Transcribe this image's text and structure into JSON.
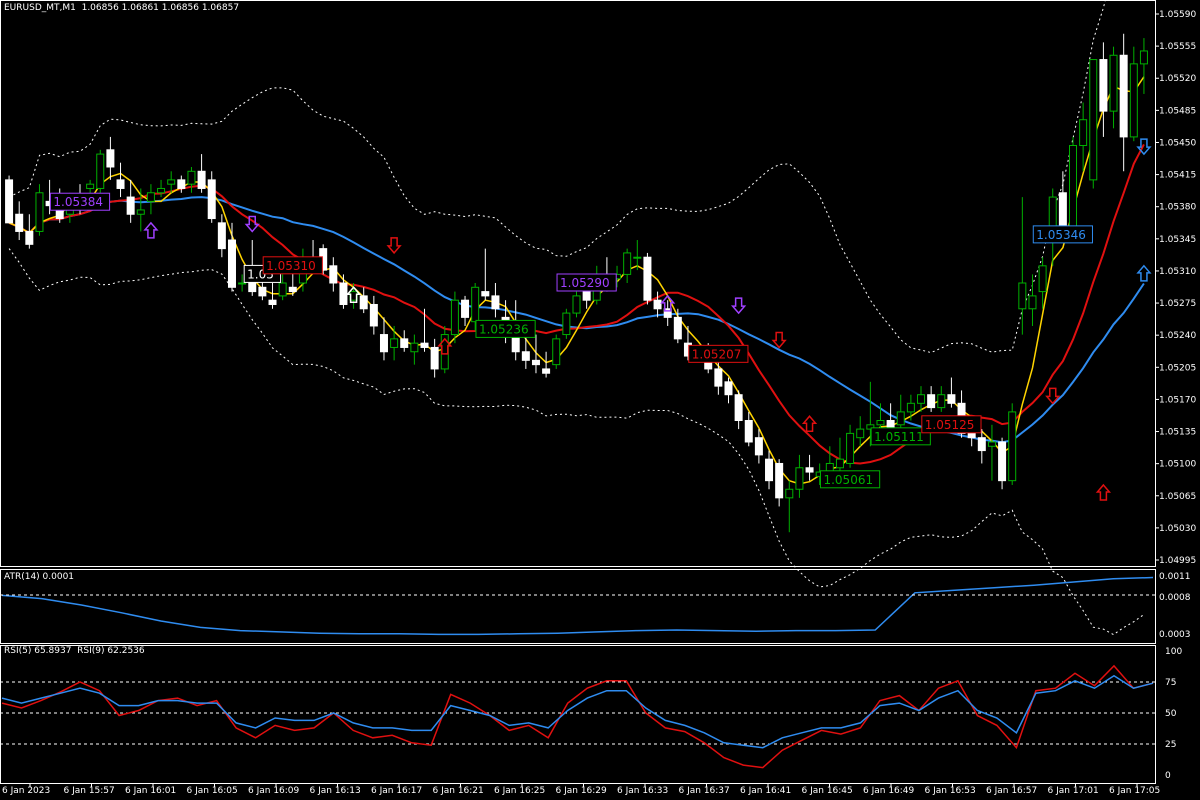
{
  "header": {
    "main": "EURUSD_MT,M1  1.06856 1.06861 1.06856 1.06857",
    "atr": "ATR(14) 0.0001",
    "rsi": "RSI(5) 65.8937  RSI(9) 62.2536"
  },
  "colors": {
    "background": "#000000",
    "frame": "#ffffff",
    "bull_body": "#000000",
    "bull_wick": "#00b000",
    "bear_body": "#ffffff",
    "bear_wick": "#ffffff",
    "ma_fast": "#ffd400",
    "ma_mid": "#e01010",
    "ma_slow": "#2f8cf0",
    "bands": "#ffffff",
    "atr": "#2f8cf0",
    "rsi5": "#e01010",
    "rsi9": "#2f8cf0"
  },
  "chart_data": [
    {
      "type": "candlestick",
      "name": "EURUSD_MT,M1",
      "ylim": [
        1.0497,
        1.0561
      ],
      "price_ticks": [
        "1.05590",
        "1.05555",
        "1.05520",
        "1.05485",
        "1.05450",
        "1.05415",
        "1.05380",
        "1.05345",
        "1.05310",
        "1.05275",
        "1.05240",
        "1.05205",
        "1.05170",
        "1.05135",
        "1.05100",
        "1.05065",
        "1.05030",
        "1.04995"
      ],
      "time_labels": [
        "6 Jan 2023",
        "6 Jan 15:57",
        "6 Jan 16:01",
        "6 Jan 16:05",
        "6 Jan 16:09",
        "6 Jan 16:13",
        "6 Jan 16:17",
        "6 Jan 16:21",
        "6 Jan 16:25",
        "6 Jan 16:29",
        "6 Jan 16:33",
        "6 Jan 16:37",
        "6 Jan 16:41",
        "6 Jan 16:45",
        "6 Jan 16:49",
        "6 Jan 16:53",
        "6 Jan 16:57",
        "6 Jan 17:01",
        "6 Jan 17:05"
      ],
      "candles": [
        [
          1.0541,
          1.05415,
          1.0536,
          1.0536
        ],
        [
          1.0537,
          1.05385,
          1.0534,
          1.0535
        ],
        [
          1.0535,
          1.0537,
          1.0533,
          1.05335
        ],
        [
          1.0535,
          1.05405,
          1.05345,
          1.05395
        ],
        [
          1.05385,
          1.0541,
          1.0537,
          1.0538
        ],
        [
          1.0538,
          1.054,
          1.0536,
          1.05365
        ],
        [
          1.0537,
          1.05395,
          1.0536,
          1.0539
        ],
        [
          1.0539,
          1.05405,
          1.0537,
          1.05385
        ],
        [
          1.054,
          1.0541,
          1.0538,
          1.05405
        ],
        [
          1.054,
          1.05445,
          1.0539,
          1.0544
        ],
        [
          1.05445,
          1.0546,
          1.0541,
          1.05425
        ],
        [
          1.0541,
          1.0543,
          1.0539,
          1.054
        ],
        [
          1.0539,
          1.0541,
          1.0536,
          1.0537
        ],
        [
          1.0537,
          1.054,
          1.0535,
          1.05375
        ],
        [
          1.05385,
          1.05405,
          1.0537,
          1.05395
        ],
        [
          1.05395,
          1.0541,
          1.0539,
          1.054
        ],
        [
          1.05405,
          1.0542,
          1.05395,
          1.0541
        ],
        [
          1.0541,
          1.05415,
          1.05395,
          1.054
        ],
        [
          1.05405,
          1.05425,
          1.05395,
          1.0542
        ],
        [
          1.0542,
          1.0544,
          1.05395,
          1.054
        ],
        [
          1.0541,
          1.0542,
          1.0536,
          1.05365
        ],
        [
          1.0536,
          1.0537,
          1.0532,
          1.0533
        ],
        [
          1.0534,
          1.0536,
          1.0528,
          1.05285
        ],
        [
          1.0529,
          1.053,
          1.0528,
          1.0529
        ],
        [
          1.053,
          1.0534,
          1.05275,
          1.0528
        ],
        [
          1.05285,
          1.0531,
          1.0527,
          1.05275
        ],
        [
          1.0527,
          1.0529,
          1.0526,
          1.05265
        ],
        [
          1.05275,
          1.053,
          1.0527,
          1.0529
        ],
        [
          1.05285,
          1.05305,
          1.05275,
          1.0528
        ],
        [
          1.0529,
          1.0533,
          1.0528,
          1.0532
        ],
        [
          1.0532,
          1.0534,
          1.0531,
          1.05315
        ],
        [
          1.0533,
          1.05335,
          1.053,
          1.05305
        ],
        [
          1.0531,
          1.0532,
          1.0528,
          1.0529
        ],
        [
          1.0529,
          1.053,
          1.0526,
          1.05265
        ],
        [
          1.0527,
          1.0529,
          1.0526,
          1.0528
        ],
        [
          1.05275,
          1.05285,
          1.05255,
          1.0526
        ],
        [
          1.05265,
          1.05275,
          1.0523,
          1.0524
        ],
        [
          1.0523,
          1.0525,
          1.052,
          1.0521
        ],
        [
          1.05215,
          1.0524,
          1.052,
          1.05225
        ],
        [
          1.05225,
          1.05235,
          1.0521,
          1.05215
        ],
        [
          1.0521,
          1.0523,
          1.05195,
          1.0522
        ],
        [
          1.0522,
          1.0526,
          1.0521,
          1.05215
        ],
        [
          1.05215,
          1.05225,
          1.0518,
          1.0519
        ],
        [
          1.0519,
          1.0524,
          1.05185,
          1.0523
        ],
        [
          1.0523,
          1.0528,
          1.0522,
          1.0527
        ],
        [
          1.0527,
          1.05275,
          1.0524,
          1.0525
        ],
        [
          1.05245,
          1.0529,
          1.05235,
          1.05285
        ],
        [
          1.0528,
          1.0533,
          1.0527,
          1.05275
        ],
        [
          1.05275,
          1.0529,
          1.0525,
          1.0526
        ],
        [
          1.0525,
          1.0527,
          1.0522,
          1.0523
        ],
        [
          1.0524,
          1.0527,
          1.052,
          1.0521
        ],
        [
          1.0521,
          1.0523,
          1.0519,
          1.052
        ],
        [
          1.052,
          1.0523,
          1.05185,
          1.05195
        ],
        [
          1.0519,
          1.0521,
          1.0518,
          1.05185
        ],
        [
          1.05195,
          1.0523,
          1.0519,
          1.05225
        ],
        [
          1.0523,
          1.0526,
          1.05225,
          1.05255
        ],
        [
          1.05255,
          1.0528,
          1.0525,
          1.05275
        ],
        [
          1.0528,
          1.053,
          1.0526,
          1.0527
        ],
        [
          1.0527,
          1.0531,
          1.05265,
          1.053
        ],
        [
          1.053,
          1.0532,
          1.0528,
          1.05295
        ],
        [
          1.05295,
          1.0531,
          1.05285,
          1.053
        ],
        [
          1.053,
          1.0533,
          1.0529,
          1.05325
        ],
        [
          1.0532,
          1.0534,
          1.05305,
          1.0532
        ],
        [
          1.0532,
          1.05325,
          1.05265,
          1.0527
        ],
        [
          1.0527,
          1.0528,
          1.0525,
          1.0526
        ],
        [
          1.0526,
          1.0527,
          1.0524,
          1.0525
        ],
        [
          1.0525,
          1.0526,
          1.0522,
          1.05225
        ],
        [
          1.0522,
          1.0524,
          1.052,
          1.05205
        ],
        [
          1.0521,
          1.05215,
          1.052,
          1.05208
        ],
        [
          1.0521,
          1.0522,
          1.05185,
          1.0519
        ],
        [
          1.0519,
          1.052,
          1.0516,
          1.0517
        ],
        [
          1.05175,
          1.0518,
          1.0515,
          1.0516
        ],
        [
          1.0516,
          1.05165,
          1.0512,
          1.0513
        ],
        [
          1.0513,
          1.0514,
          1.051,
          1.05105
        ],
        [
          1.0511,
          1.0512,
          1.0508,
          1.0509
        ],
        [
          1.05085,
          1.05095,
          1.0505,
          1.0506
        ],
        [
          1.0508,
          1.05085,
          1.0503,
          1.0504
        ],
        [
          1.0504,
          1.0506,
          1.05,
          1.0505
        ],
        [
          1.0505,
          1.0509,
          1.0504,
          1.05075
        ],
        [
          1.05075,
          1.0509,
          1.0506,
          1.0507
        ],
        [
          1.05065,
          1.0508,
          1.05055,
          1.0507
        ],
        [
          1.0507,
          1.051,
          1.0506,
          1.0508
        ],
        [
          1.05075,
          1.0511,
          1.0506,
          1.05085
        ],
        [
          1.0508,
          1.05125,
          1.05075,
          1.05115
        ],
        [
          1.0511,
          1.05135,
          1.051,
          1.0512
        ],
        [
          1.0512,
          1.05175,
          1.051,
          1.05125
        ],
        [
          1.05125,
          1.0515,
          1.0511,
          1.0513
        ],
        [
          1.0513,
          1.0515,
          1.05115,
          1.0512
        ],
        [
          1.05125,
          1.0516,
          1.0511,
          1.0514
        ],
        [
          1.0514,
          1.0516,
          1.0513,
          1.0515
        ],
        [
          1.0515,
          1.0517,
          1.0514,
          1.0516
        ],
        [
          1.0516,
          1.0517,
          1.0514,
          1.05145
        ],
        [
          1.05145,
          1.0517,
          1.0514,
          1.0516
        ],
        [
          1.0516,
          1.0518,
          1.05145,
          1.0515
        ],
        [
          1.0515,
          1.05165,
          1.0511,
          1.05115
        ],
        [
          1.0512,
          1.0513,
          1.051,
          1.0511
        ],
        [
          1.0511,
          1.0512,
          1.0508,
          1.05095
        ],
        [
          1.051,
          1.05125,
          1.0506,
          1.05105
        ],
        [
          1.05105,
          1.0511,
          1.0505,
          1.0506
        ],
        [
          1.0506,
          1.0515,
          1.05055,
          1.0514
        ],
        [
          1.0526,
          1.0539,
          1.0523,
          1.0529
        ],
        [
          1.0526,
          1.053,
          1.0524,
          1.05275
        ],
        [
          1.0528,
          1.0532,
          1.0526,
          1.0531
        ],
        [
          1.0534,
          1.054,
          1.0531,
          1.0539
        ],
        [
          1.05395,
          1.0542,
          1.0534,
          1.0535
        ],
        [
          1.0535,
          1.0546,
          1.0534,
          1.0545
        ],
        [
          1.0545,
          1.055,
          1.0542,
          1.0548
        ],
        [
          1.0541,
          1.0555,
          1.054,
          1.0555
        ],
        [
          1.0555,
          1.0557,
          1.0546,
          1.0549
        ],
        [
          1.0549,
          1.05565,
          1.0547,
          1.05555
        ],
        [
          1.05555,
          1.0558,
          1.0542,
          1.0546
        ],
        [
          1.0546,
          1.05565,
          1.05455,
          1.05545
        ],
        [
          1.05545,
          1.05575,
          1.0551,
          1.0556
        ]
      ]
    },
    {
      "type": "line",
      "name": "ATR(14)",
      "ylim": [
        0.0002,
        0.0012
      ],
      "ticks": [
        "0.0011",
        "0.0008",
        "0.0003"
      ],
      "values": [
        0.00085,
        0.0008,
        0.0007,
        0.00058,
        0.00045,
        0.00035,
        0.0003,
        0.00028,
        0.00026,
        0.00025,
        0.00025,
        0.00024,
        0.00024,
        0.00025,
        0.00026,
        0.00028,
        0.0003,
        0.00031,
        0.0003,
        0.00029,
        0.0003,
        0.0003,
        0.00031,
        0.00089,
        0.00093,
        0.00097,
        0.00101,
        0.00106,
        0.00111,
        0.00113
      ]
    },
    {
      "type": "line",
      "name": "RSI",
      "ylim": [
        0,
        100
      ],
      "ticks": [
        "100",
        "75",
        "50",
        "25",
        "0"
      ],
      "series": [
        {
          "name": "RSI(5) 65.8937",
          "values": [
            58,
            54,
            60,
            67,
            75,
            68,
            48,
            52,
            60,
            62,
            56,
            60,
            38,
            30,
            40,
            36,
            38,
            50,
            36,
            30,
            32,
            26,
            24,
            65,
            58,
            48,
            36,
            40,
            30,
            58,
            70,
            76,
            76,
            50,
            38,
            35,
            26,
            14,
            8,
            6,
            20,
            28,
            36,
            33,
            38,
            60,
            64,
            52,
            70,
            76,
            48,
            40,
            22,
            68,
            70,
            82,
            72,
            88,
            70,
            74
          ]
        },
        {
          "name": "RSI(9) 62.2536",
          "values": [
            62,
            58,
            62,
            66,
            70,
            66,
            56,
            56,
            60,
            60,
            58,
            58,
            42,
            38,
            46,
            44,
            44,
            50,
            42,
            38,
            38,
            36,
            36,
            56,
            52,
            48,
            40,
            42,
            38,
            52,
            62,
            68,
            68,
            54,
            44,
            40,
            34,
            26,
            24,
            22,
            30,
            34,
            38,
            38,
            42,
            56,
            58,
            52,
            62,
            68,
            52,
            46,
            34,
            66,
            68,
            76,
            70,
            80,
            70,
            74
          ]
        }
      ]
    }
  ],
  "price_tags": [
    {
      "text": "1.05384",
      "color": "#a040ff",
      "price": 1.05384,
      "bar": 7
    },
    {
      "text": "1.05",
      "color": "#ffffff",
      "price": 1.053,
      "bar": 25
    },
    {
      "text": "1.05310",
      "color": "#e01010",
      "price": 1.0531,
      "bar": 28
    },
    {
      "text": "1.05236",
      "color": "#00b000",
      "price": 1.05236,
      "bar": 49
    },
    {
      "text": "1.05290",
      "color": "#a040ff",
      "price": 1.0529,
      "bar": 57
    },
    {
      "text": "1.05207",
      "color": "#e01010",
      "price": 1.05207,
      "bar": 70
    },
    {
      "text": "1.05111",
      "color": "#00b000",
      "price": 1.05111,
      "bar": 88
    },
    {
      "text": "1.05061",
      "color": "#00b000",
      "price": 1.05061,
      "bar": 83
    },
    {
      "text": "1.05125",
      "color": "#e01010",
      "price": 1.05125,
      "bar": 93
    },
    {
      "text": "1.05346",
      "color": "#2f8cf0",
      "price": 1.05346,
      "bar": 104
    }
  ],
  "signal_arrows": [
    {
      "dir": "up",
      "color": "#a040ff",
      "bar": 8,
      "price": 1.0536
    },
    {
      "dir": "down",
      "color": "#a040ff",
      "bar": 14,
      "price": 1.0535
    },
    {
      "dir": "down",
      "color": "#e01010",
      "bar": 22,
      "price": 1.05325
    },
    {
      "dir": "up",
      "color": "#ffffff",
      "bar": 20,
      "price": 1.05285
    },
    {
      "dir": "up",
      "color": "#e01010",
      "bar": 25,
      "price": 1.05225
    },
    {
      "dir": "up",
      "color": "#a040ff",
      "bar": 38,
      "price": 1.05275
    },
    {
      "dir": "down",
      "color": "#a040ff",
      "bar": 42,
      "price": 1.05255
    },
    {
      "dir": "down",
      "color": "#e01010",
      "bar": 44,
      "price": 1.05215
    },
    {
      "dir": "up",
      "color": "#e01010",
      "bar": 46,
      "price": 1.05135
    },
    {
      "dir": "down",
      "color": "#e01010",
      "bar": 60,
      "price": 1.0515
    },
    {
      "dir": "up",
      "color": "#e01010",
      "bar": 63,
      "price": 1.05055
    },
    {
      "dir": "down",
      "color": "#2f8cf0",
      "bar": 67,
      "price": 1.0544
    },
    {
      "dir": "up",
      "color": "#2f8cf0",
      "bar": 66,
      "price": 1.0531
    }
  ]
}
